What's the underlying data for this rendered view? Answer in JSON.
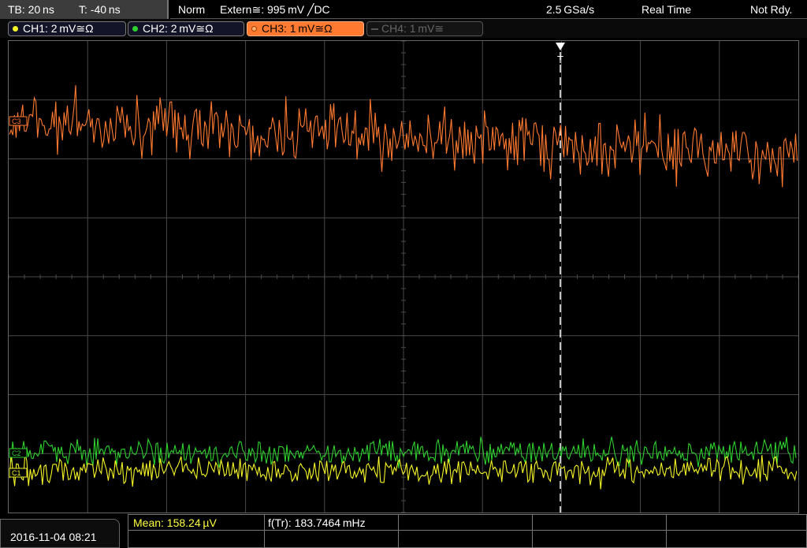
{
  "topbar": {
    "timebase": "TB: 20 ns",
    "trigger_offset": "T: -40 ns",
    "trigger_mode": "Norm",
    "trigger_source": "Extern≅: 995 mV ╱DC",
    "sample_rate": "2.5 GSa/s",
    "acq_mode": "Real Time",
    "status": "Not Rdy."
  },
  "channels": [
    {
      "label": "CH1: 2 mV≅Ω",
      "color": "#f5f528",
      "active": true
    },
    {
      "label": "CH2: 2 mV≅Ω",
      "color": "#2ed12e",
      "active": true
    },
    {
      "label": "CH3: 1 mV≅Ω",
      "color": "#ff7a30",
      "active": true,
      "selected": true
    },
    {
      "label": "CH4: 1 mV≅",
      "color": "#666666",
      "active": false
    }
  ],
  "markers": {
    "ch3": "C3",
    "ch2": "C2",
    "ch1": "C1",
    "trigger": "T"
  },
  "measurements": {
    "mean": "Mean: 158.24 µV",
    "freq": "f(Tr): 183.7464 mHz"
  },
  "datetime": "2016-11-04 08:21",
  "colors": {
    "ch1": "#f5f528",
    "ch2": "#2ed12e",
    "ch3": "#ff7a30",
    "grid": "#555555",
    "mean_label": "#ffff40"
  }
}
